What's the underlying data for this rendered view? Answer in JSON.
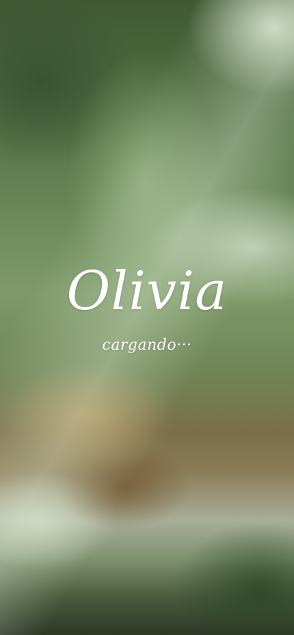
{
  "splash": {
    "app_name": "Olivia",
    "status_text": "cargando···"
  },
  "colors": {
    "text": "#ffffff",
    "background_tint": "#5f7f50"
  }
}
